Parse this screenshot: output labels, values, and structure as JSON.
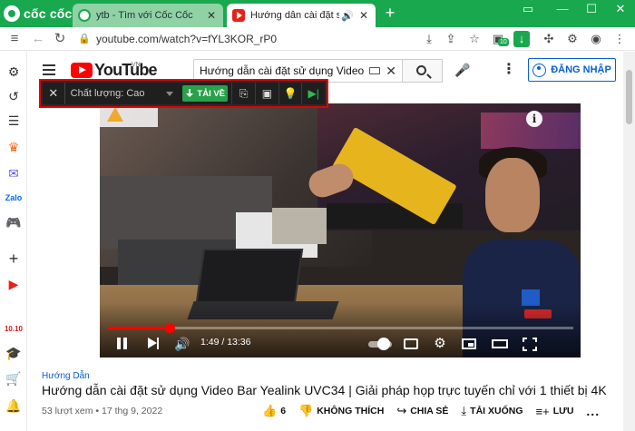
{
  "browser": {
    "brand": "cốc cốc",
    "tabs": [
      {
        "title": "ytb - Tìm với Cốc Cốc",
        "active": false,
        "icon": "coccoc-icon"
      },
      {
        "title": "Hướng dẫn cài đặt sử dụng",
        "active": true,
        "icon": "youtube-icon",
        "audio": true
      }
    ],
    "new_tab": "+",
    "url": "youtube.com/watch?v=fYL3KOR_rP0",
    "extension_badge": "10",
    "accent": "#1aa84f"
  },
  "sidebar": {
    "items": [
      "gear-icon",
      "history-icon",
      "list-icon",
      "crown-icon",
      "messenger-icon",
      "zalo-icon",
      "gamepad-icon",
      "plus-icon",
      "youtube-icon",
      "calendar-icon",
      "hat-icon",
      "cart-icon",
      "bell-icon"
    ]
  },
  "youtube": {
    "logo": "YouTube",
    "country": "VN",
    "search_value": "Hướng dẫn cài đặt sử dụng Video Bar",
    "signin": "ĐĂNG NHẬP"
  },
  "download_bar": {
    "quality": "Chất lượng: Cao",
    "download_label": "TẢI VỀ",
    "highlight": "#e30000"
  },
  "player": {
    "time": "1:49 / 13:36",
    "progress_fraction": 0.1336
  },
  "video": {
    "category": "Hướng Dẫn",
    "title": "Hướng dẫn cài đặt sử dụng Video Bar Yealink UVC34 | Giải pháp họp trực tuyến chỉ với 1 thiết bị 4K",
    "meta": "53 lượt xem • 17 thg 9, 2022",
    "likes": "6",
    "dislike": "KHÔNG THÍCH",
    "share": "CHIA SẺ",
    "download": "TẢI XUỐNG",
    "save": "LƯU",
    "more": "..."
  }
}
